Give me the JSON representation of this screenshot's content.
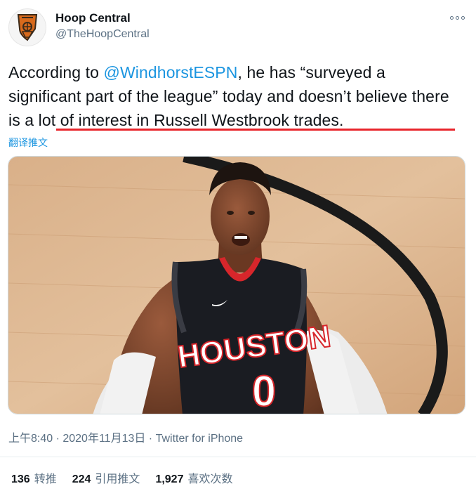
{
  "account": {
    "name": "Hoop Central",
    "handle": "@TheHoopCentral"
  },
  "tweet": {
    "text_before": "According to ",
    "mention": "@WindhorstESPN",
    "text_after": ", he has “surveyed a significant part of the league” today and doesn’t believe there is a lot of interest in Russell Westbrook trades.",
    "translate_label": "翻译推文",
    "meta": "上午8:40 · 2020年11月13日 · Twitter for iPhone"
  },
  "media": {
    "jersey_text": "HOUSTON",
    "jersey_number": "0"
  },
  "stats": {
    "retweets_count": "136",
    "retweets_label": "转推",
    "quotes_count": "224",
    "quotes_label": "引用推文",
    "likes_count": "1,927",
    "likes_label": "喜欢次数"
  },
  "colors": {
    "link": "#1b95e0",
    "highlight_underline": "#e8242b",
    "secondary_text": "#5b7083"
  },
  "icons": {
    "more": "more-options-icon",
    "avatar": "hoop-central-logo"
  }
}
